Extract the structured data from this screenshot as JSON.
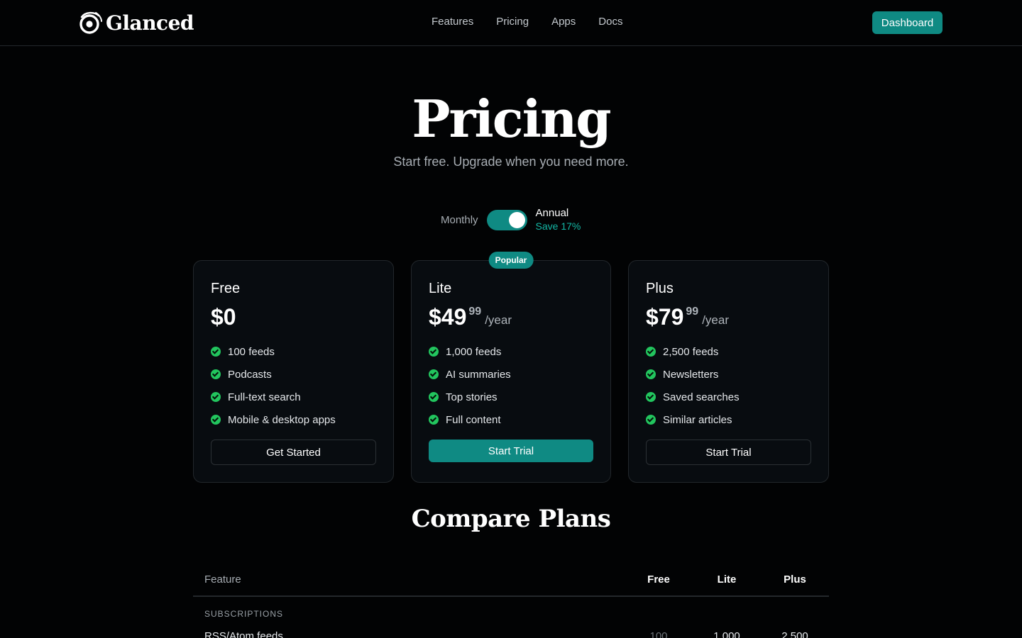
{
  "brand": {
    "name": "Glanced"
  },
  "nav": {
    "links": [
      "Features",
      "Pricing",
      "Apps",
      "Docs"
    ],
    "dashboard_label": "Dashboard"
  },
  "hero": {
    "title": "Pricing",
    "subtitle": "Start free. Upgrade when you need more."
  },
  "billing": {
    "monthly_label": "Monthly",
    "annual_label": "Annual",
    "save_label": "Save 17%",
    "annual_selected": true
  },
  "plans": [
    {
      "name": "Free",
      "price": "$0",
      "cents": "",
      "period": "",
      "badge": "",
      "features": [
        "100 feeds",
        "Podcasts",
        "Full-text search",
        "Mobile & desktop apps"
      ],
      "cta": "Get Started"
    },
    {
      "name": "Lite",
      "price": "$49",
      "cents": "99",
      "period": "/year",
      "badge": "Popular",
      "features": [
        "1,000 feeds",
        "AI summaries",
        "Top stories",
        "Full content"
      ],
      "cta": "Start Trial"
    },
    {
      "name": "Plus",
      "price": "$79",
      "cents": "99",
      "period": "/year",
      "badge": "",
      "features": [
        "2,500 feeds",
        "Newsletters",
        "Saved searches",
        "Similar articles"
      ],
      "cta": "Start Trial"
    }
  ],
  "compare": {
    "title": "Compare Plans",
    "columns": [
      "Feature",
      "Free",
      "Lite",
      "Plus"
    ],
    "section": "SUBSCRIPTIONS",
    "rows": [
      {
        "name": "RSS/Atom feeds",
        "free": "100",
        "lite": "1,000",
        "plus": "2,500"
      }
    ]
  },
  "colors": {
    "accent": "#0f8a83",
    "check": "#22c55e",
    "save_text": "#14b8a6",
    "background": "#020304"
  }
}
